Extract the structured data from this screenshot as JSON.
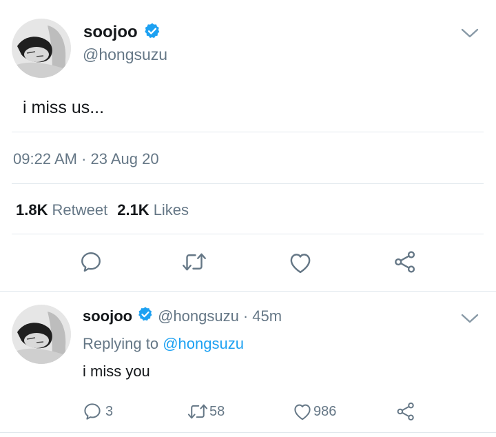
{
  "main_tweet": {
    "author_name": "soojoo",
    "author_handle": "@hongsuzu",
    "text": "i miss us...",
    "timestamp": "09:22 AM · 23 Aug 20",
    "retweet_count": "1.8K",
    "retweet_label": "Retweet",
    "like_count": "2.1K",
    "like_label": "Likes"
  },
  "reply_tweet": {
    "author_name": "soojoo",
    "author_handle": "@hongsuzu",
    "time_ago": "· 45m",
    "replying_to_label": "Replying to",
    "replying_to_handle": "@hongsuzu",
    "text": "i miss you",
    "reply_count": "3",
    "retweet_count": "58",
    "like_count": "986"
  },
  "colors": {
    "verified": "#1da1f2",
    "link": "#1da1f2",
    "muted": "#657786",
    "divider": "#e1e8ed"
  },
  "icons": {
    "verified": "verified-badge-icon",
    "chevron": "chevron-down-icon",
    "reply": "reply-icon",
    "retweet": "retweet-icon",
    "like": "heart-icon",
    "share": "share-icon"
  }
}
